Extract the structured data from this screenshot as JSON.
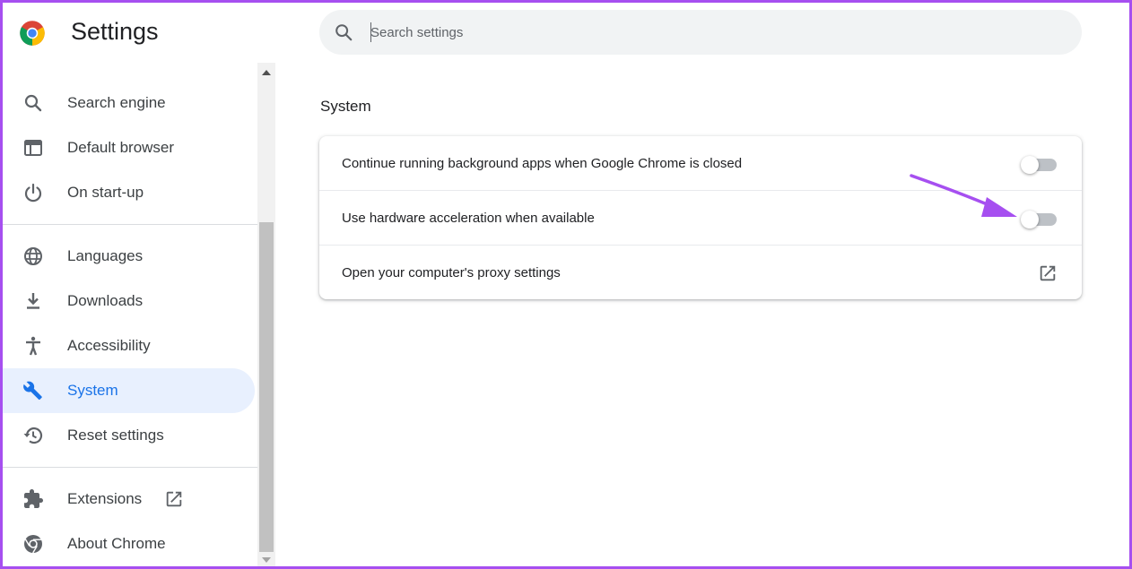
{
  "app": {
    "title": "Settings",
    "logo_icon": "chrome-logo-icon"
  },
  "search": {
    "placeholder": "Search settings",
    "value": ""
  },
  "sidebar": {
    "items": [
      {
        "label": "Search engine",
        "icon": "search-icon"
      },
      {
        "label": "Default browser",
        "icon": "browser-window-icon"
      },
      {
        "label": "On start-up",
        "icon": "power-icon"
      },
      {
        "label": "Languages",
        "icon": "globe-icon"
      },
      {
        "label": "Downloads",
        "icon": "download-icon"
      },
      {
        "label": "Accessibility",
        "icon": "accessibility-icon"
      },
      {
        "label": "System",
        "icon": "wrench-icon",
        "selected": true
      },
      {
        "label": "Reset settings",
        "icon": "restore-icon"
      },
      {
        "label": "Extensions",
        "icon": "puzzle-icon",
        "external": true
      },
      {
        "label": "About Chrome",
        "icon": "chrome-outline-icon"
      }
    ]
  },
  "main": {
    "section_title": "System",
    "rows": [
      {
        "label": "Continue running background apps when Google Chrome is closed",
        "control": "toggle",
        "enabled": false
      },
      {
        "label": "Use hardware acceleration when available",
        "control": "toggle",
        "enabled": false
      },
      {
        "label": "Open your computer's proxy settings",
        "control": "external-link"
      }
    ]
  },
  "colors": {
    "accent": "#1a73e8",
    "selected_bg": "#e8f0fe",
    "annotation": "#a64ff0",
    "frame": "#a64ff0"
  }
}
